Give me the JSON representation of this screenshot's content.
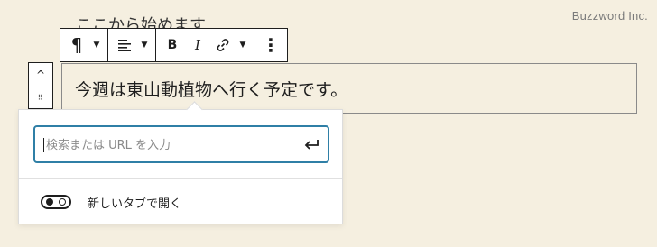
{
  "watermark": "Buzzword Inc.",
  "previous_block_text": "ここから始めます",
  "toolbar": {
    "paragraph_icon": "¶",
    "align_icon": "≡",
    "bold_label": "B",
    "italic_label": "I",
    "more_icon": "⋮"
  },
  "block": {
    "text": "今週は東山動植物へ行く予定です。"
  },
  "link_popover": {
    "search_placeholder": "検索または URL を入力",
    "search_value": "",
    "new_tab_label": "新しいタブで開く",
    "new_tab_enabled": false
  },
  "colors": {
    "accent": "#2f7fa6",
    "background": "#f5efe0"
  }
}
